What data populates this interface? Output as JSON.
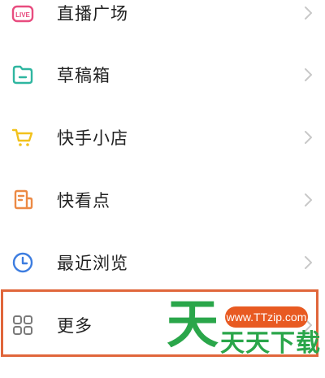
{
  "menu": {
    "items": [
      {
        "label": "直播广场",
        "icon": "live-icon"
      },
      {
        "label": "草稿箱",
        "icon": "folder-icon"
      },
      {
        "label": "快手小店",
        "icon": "cart-icon"
      },
      {
        "label": "快看点",
        "icon": "news-icon"
      },
      {
        "label": "最近浏览",
        "icon": "clock-icon"
      },
      {
        "label": "更多",
        "icon": "grid-icon"
      }
    ]
  },
  "icons": {
    "live_badge": "LIVE"
  },
  "watermark": {
    "logo_char": "天",
    "url": "www.TTzip.com",
    "name": "天天下载"
  },
  "colors": {
    "pink": "#e84c7f",
    "green": "#2fb6a0",
    "yellow": "#f2c21c",
    "orange": "#ec8a45",
    "blue": "#3d7de0",
    "gray": "#7a7a7a",
    "chevron": "#c8c8c8",
    "highlight": "#e0663b",
    "watermark_green": "#2aa64a",
    "watermark_orange": "#e85a22"
  }
}
